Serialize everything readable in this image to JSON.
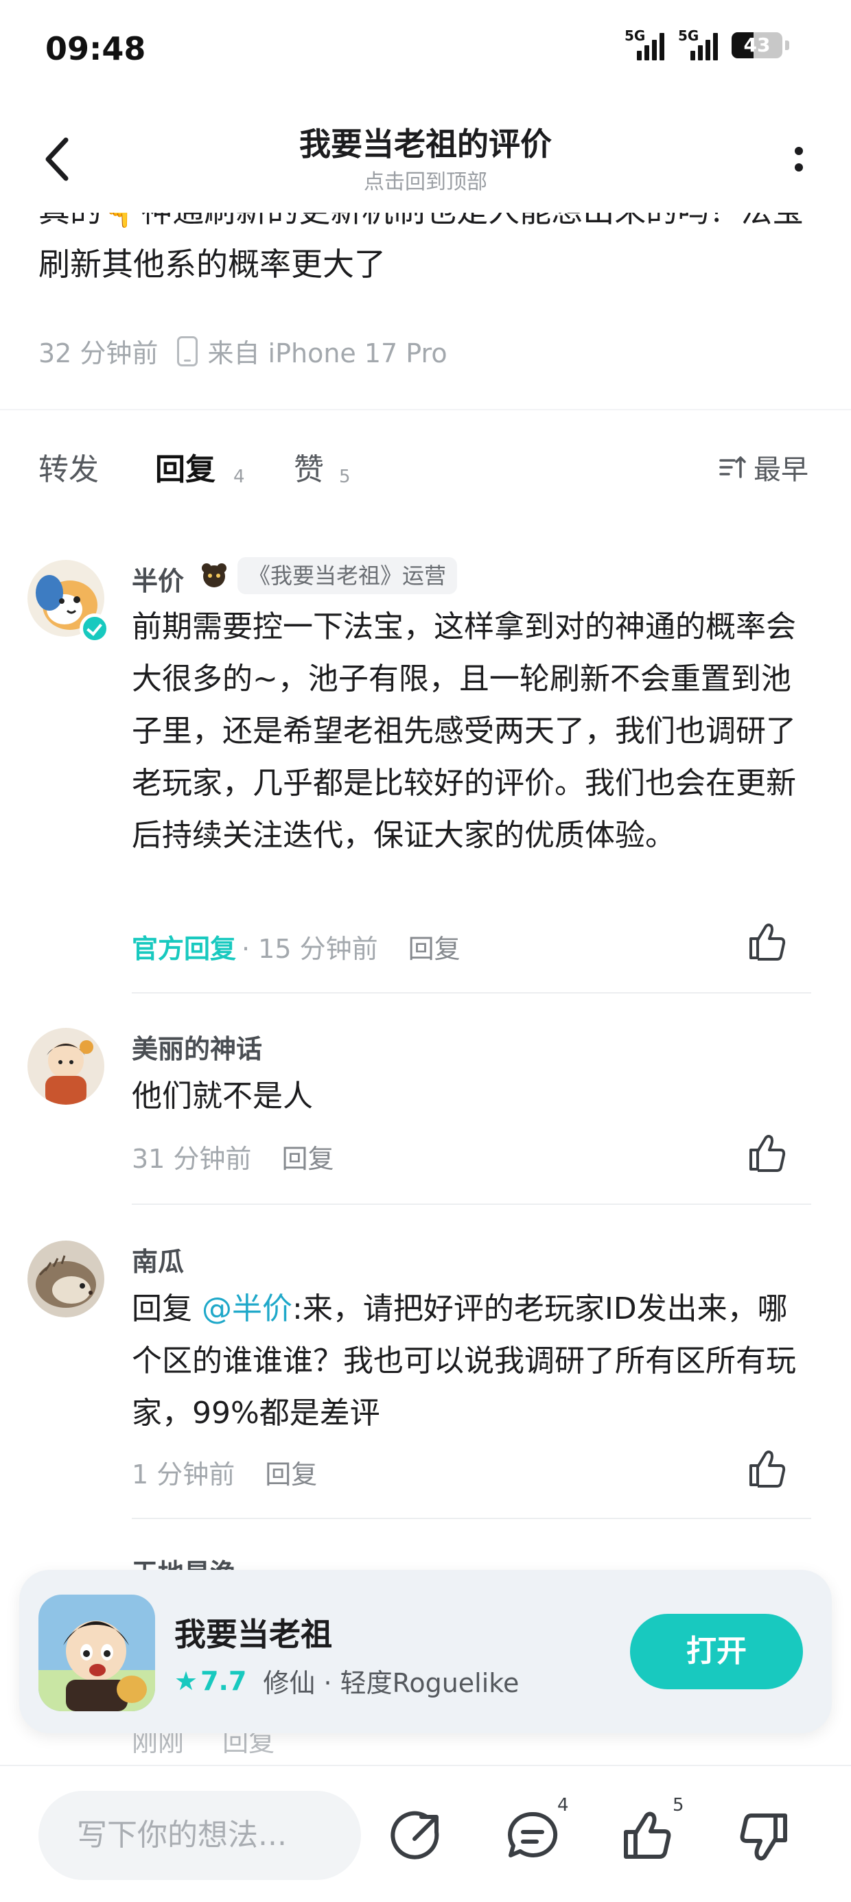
{
  "status_bar": {
    "time": "09:48",
    "network_1": "5G",
    "network_2": "5G",
    "battery": "43"
  },
  "nav": {
    "title": "我要当老祖的评价",
    "subtitle": "点击回到顶部"
  },
  "post": {
    "text": "真的👇神通刷新的更新机制也是人能想出来的吗？法宝刷新其他系的概率更大了",
    "time": "32 分钟前",
    "device": "来自 iPhone 17 Pro"
  },
  "tabs": {
    "repost": "转发",
    "reply": "回复",
    "reply_count": "4",
    "like": "赞",
    "like_count": "5",
    "sort": "最早"
  },
  "comments": [
    {
      "name": "半价",
      "badge": "《我要当老祖》运营",
      "text": "前期需要控一下法宝，这样拿到对的神通的概率会大很多的~，池子有限，且一轮刷新不会重置到池子里，还是希望老祖先感受两天了，我们也调研了老玩家，几乎都是比较好的评价。我们也会在更新后持续关注迭代，保证大家的优质体验。",
      "official": "官方回复",
      "time": "· 15 分钟前",
      "reply": "回复"
    },
    {
      "name": "美丽的神话",
      "text": "他们就不是人",
      "time": "31 分钟前",
      "reply": "回复"
    },
    {
      "name": "南瓜",
      "reply_prefix": "回复 ",
      "mention": "@半价",
      "text": ":来，请把好评的老玩家ID发出来，哪个区的谁谁谁？我也可以说我调研了所有区所有玩家，99%都是差评",
      "time": "1 分钟前",
      "reply": "回复"
    }
  ],
  "hidden_comment": {
    "name": "天地星渔",
    "time": "刚刚",
    "reply": "回复"
  },
  "app_card": {
    "name": "我要当老祖",
    "rating": "7.7",
    "category": "修仙 · 轻度Roguelike",
    "open": "打开"
  },
  "bottom_bar": {
    "placeholder": "写下你的想法...",
    "comment_count": "4",
    "like_count": "5"
  },
  "colors": {
    "accent": "#18c9bf",
    "mention": "#1fa8c9",
    "muted": "#a3a8ad"
  }
}
